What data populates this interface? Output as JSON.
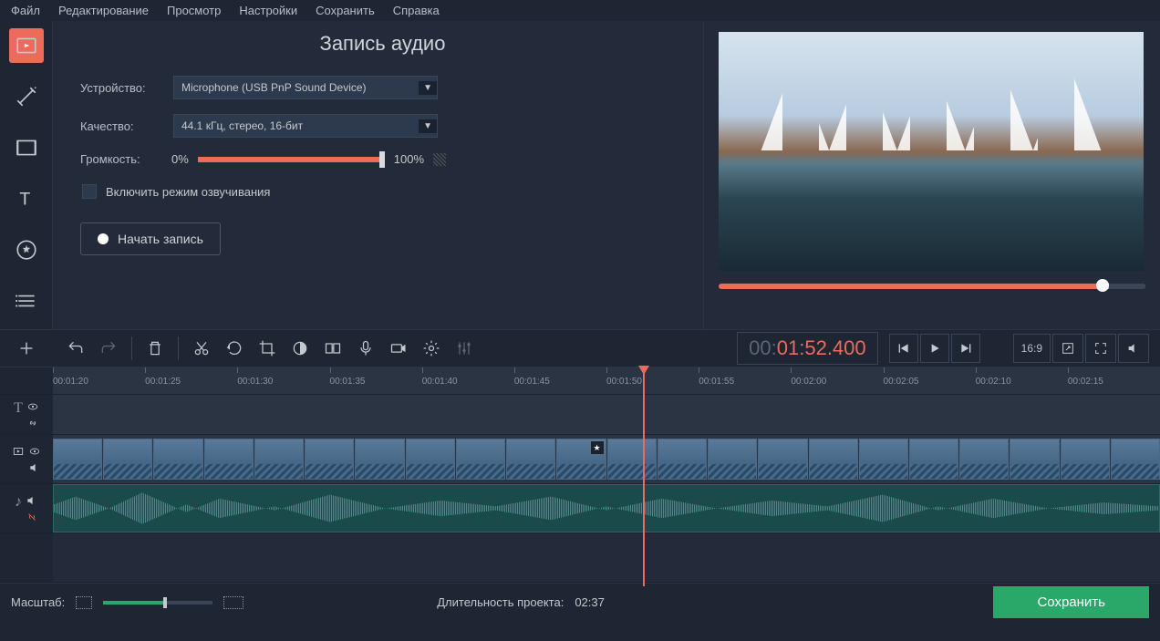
{
  "menu": {
    "file": "Файл",
    "edit": "Редактирование",
    "view": "Просмотр",
    "settings": "Настройки",
    "save": "Сохранить",
    "help": "Справка"
  },
  "panel": {
    "title": "Запись аудио",
    "device_label": "Устройство:",
    "device_value": "Microphone (USB PnP Sound Device)",
    "quality_label": "Качество:",
    "quality_value": "44.1 кГц, стерео, 16-бит",
    "volume_label": "Громкость:",
    "volume_min": "0%",
    "volume_max": "100%",
    "dub_label": "Включить режим озвучивания",
    "record_label": "Начать запись"
  },
  "help_icon": "?",
  "timecode": {
    "grey": "00:",
    "orange": "01:52.400"
  },
  "aspect": "16:9",
  "ruler": [
    "00:01:20",
    "00:01:25",
    "00:01:30",
    "00:01:35",
    "00:01:40",
    "00:01:45",
    "00:01:50",
    "00:01:55",
    "00:02:00",
    "00:02:05",
    "00:02:10",
    "00:02:15"
  ],
  "bottom": {
    "scale_label": "Масштаб:",
    "duration_label": "Длительность проекта:",
    "duration_value": "02:37",
    "save_button": "Сохранить"
  }
}
